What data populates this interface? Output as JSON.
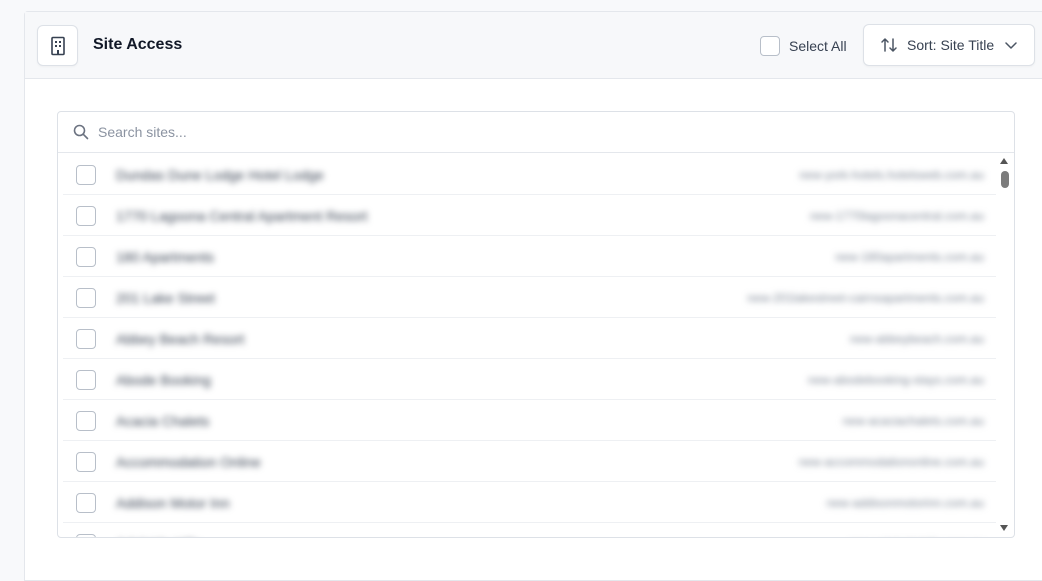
{
  "header": {
    "title": "Site Access",
    "icon": "building-icon",
    "select_all_label": "Select All",
    "sort_label": "Sort: Site Title"
  },
  "search": {
    "placeholder": "Search sites..."
  },
  "sites": [
    {
      "name": "Dundas Dune Lodge Hotel Lodge",
      "domain": "new-york-hotels.hotelsweb.com.au"
    },
    {
      "name": "1770 Lagoona Central Apartment Resort",
      "domain": "new-1770lagoonacentral.com.au"
    },
    {
      "name": "180 Apartments",
      "domain": "new-180apartments.com.au"
    },
    {
      "name": "201 Lake Street",
      "domain": "new-201lakestreet-cairnsapartments.com.au"
    },
    {
      "name": "Abbey Beach Resort",
      "domain": "new-abbeybeach.com.au"
    },
    {
      "name": "Abode Booking",
      "domain": "new-abodebooking-stays.com.au"
    },
    {
      "name": "Acacia Chalets",
      "domain": "new-acaciachalets.com.au"
    },
    {
      "name": "Accommodation Online",
      "domain": "new-accommodationonline.com.au"
    },
    {
      "name": "Addison Motor Inn",
      "domain": "new-addisonmotorinn.com.au"
    },
    {
      "name": "Adelaide Hills",
      "domain": "new-adelaidehills.com.au"
    }
  ],
  "colors": {
    "border": "#dde1e7",
    "header_bg": "#f7f8fa",
    "text": "#111827"
  }
}
